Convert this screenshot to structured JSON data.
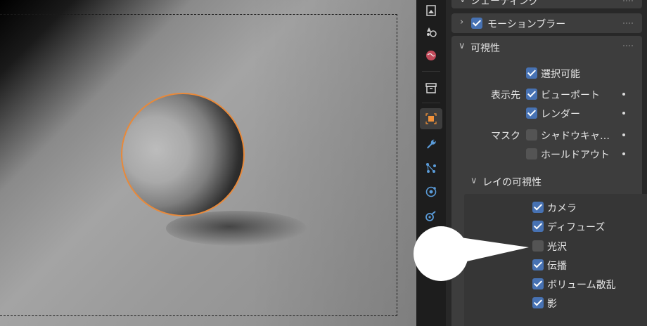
{
  "panels": {
    "top_partial_label": "シェーディング",
    "motion_blur": {
      "label": "モーションブラー",
      "checked": true
    },
    "visibility": {
      "label": "可視性",
      "selectable": {
        "label": "選択可能",
        "checked": true
      },
      "show_in_label": "表示先",
      "viewport": {
        "label": "ビューポート",
        "checked": true
      },
      "render": {
        "label": "レンダー",
        "checked": true
      },
      "mask_label": "マスク",
      "shadow_catcher": {
        "label": "シャドウキャ…",
        "checked": false
      },
      "holdout": {
        "label": "ホールドアウト",
        "checked": false
      },
      "ray_visibility": {
        "label": "レイの可視性",
        "items": [
          {
            "label": "カメラ",
            "checked": true
          },
          {
            "label": "ディフューズ",
            "checked": true
          },
          {
            "label": "光沢",
            "checked": false
          },
          {
            "label": "伝播",
            "checked": true
          },
          {
            "label": "ボリューム散乱",
            "checked": true
          },
          {
            "label": "影",
            "checked": true
          }
        ]
      }
    }
  },
  "tabs": [
    "texture-tab",
    "particles-tab",
    "world-tab",
    "collection-tab",
    "object-tab",
    "modifier-tab",
    "particle-system-tab",
    "physics-tab",
    "constraints-tab"
  ],
  "colors": {
    "accent": "#4772b3",
    "selection": "#e8893a",
    "active_object_tab": "#f0913a"
  }
}
